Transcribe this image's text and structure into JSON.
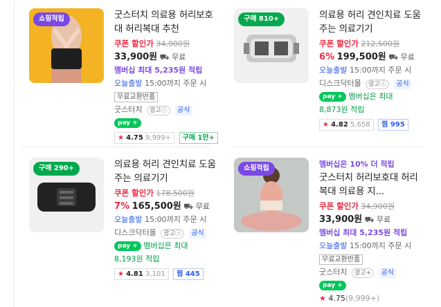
{
  "products": [
    {
      "badge": "쇼핑적립",
      "title": "굿스터치 의료용 허리보호대 허리복대 추천",
      "coupon_label": "쿠폰 할인가",
      "original_price": "34,900원",
      "discount": "",
      "price": "33,900원",
      "shipping": "무료",
      "member_text": "멤버십 최대 5,235원 적립",
      "delivery": "오늘출발",
      "delivery_detail": "15:00까지 주문 시",
      "exchange": "무료교환반품",
      "seller": "굿스터치",
      "ad_label": "광고",
      "official": "공식",
      "npay": "pay +",
      "rating": "4.75",
      "reviews": "9,999+",
      "tag": "구매 1만+"
    },
    {
      "badge": "구매 810+",
      "title": "의료용 허리 견인치료 도움주는 의료기기",
      "coupon_label": "쿠폰 할인가",
      "original_price": "212,500원",
      "discount": "6%",
      "price": "199,500원",
      "shipping": "무료",
      "delivery": "오늘출발",
      "delivery_detail": "15:00까지 주문 시",
      "seller": "디스크닥터몰",
      "ad_label": "광고",
      "official": "공식",
      "npay": "pay +",
      "member_text": "멤버십은 최대",
      "member_amount": "8,873원 적립",
      "rating": "4.82",
      "reviews": "5,658",
      "tag": "찜 995"
    },
    {
      "badge": "구매 290+",
      "title": "의료용 허리 견인치료 도움주는 의료기기",
      "coupon_label": "쿠폰 할인가",
      "original_price": "178,500원",
      "discount": "7%",
      "price": "165,500원",
      "shipping": "무료",
      "delivery": "오늘출발",
      "delivery_detail": "15:00까지 주문 시",
      "seller": "디스크닥터몰",
      "ad_label": "광고",
      "official": "공식",
      "npay": "pay +",
      "member_text": "멤버십은 최대",
      "member_amount": "8,193원 적립",
      "rating": "4.81",
      "reviews": "3,101",
      "tag": "찜 445"
    },
    {
      "badge": "쇼핑적립",
      "top_note": "멤버십은 10% 더 적립",
      "title": "굿스터치 허리보호대 허리복대 의료용 지...",
      "coupon_label": "쿠폰 할인가",
      "original_price": "34,900원",
      "price": "33,900원",
      "shipping": "무료",
      "member_text": "멤버십 최대 5,235원 적립",
      "delivery": "오늘출발",
      "delivery_detail": "15:00까지 주문 시",
      "exchange": "무료교환반품",
      "seller": "굿스터치",
      "ad_label": "광고",
      "official": "공식",
      "npay": "pay +",
      "rating": "4.75",
      "reviews": "(9,999+)"
    }
  ]
}
